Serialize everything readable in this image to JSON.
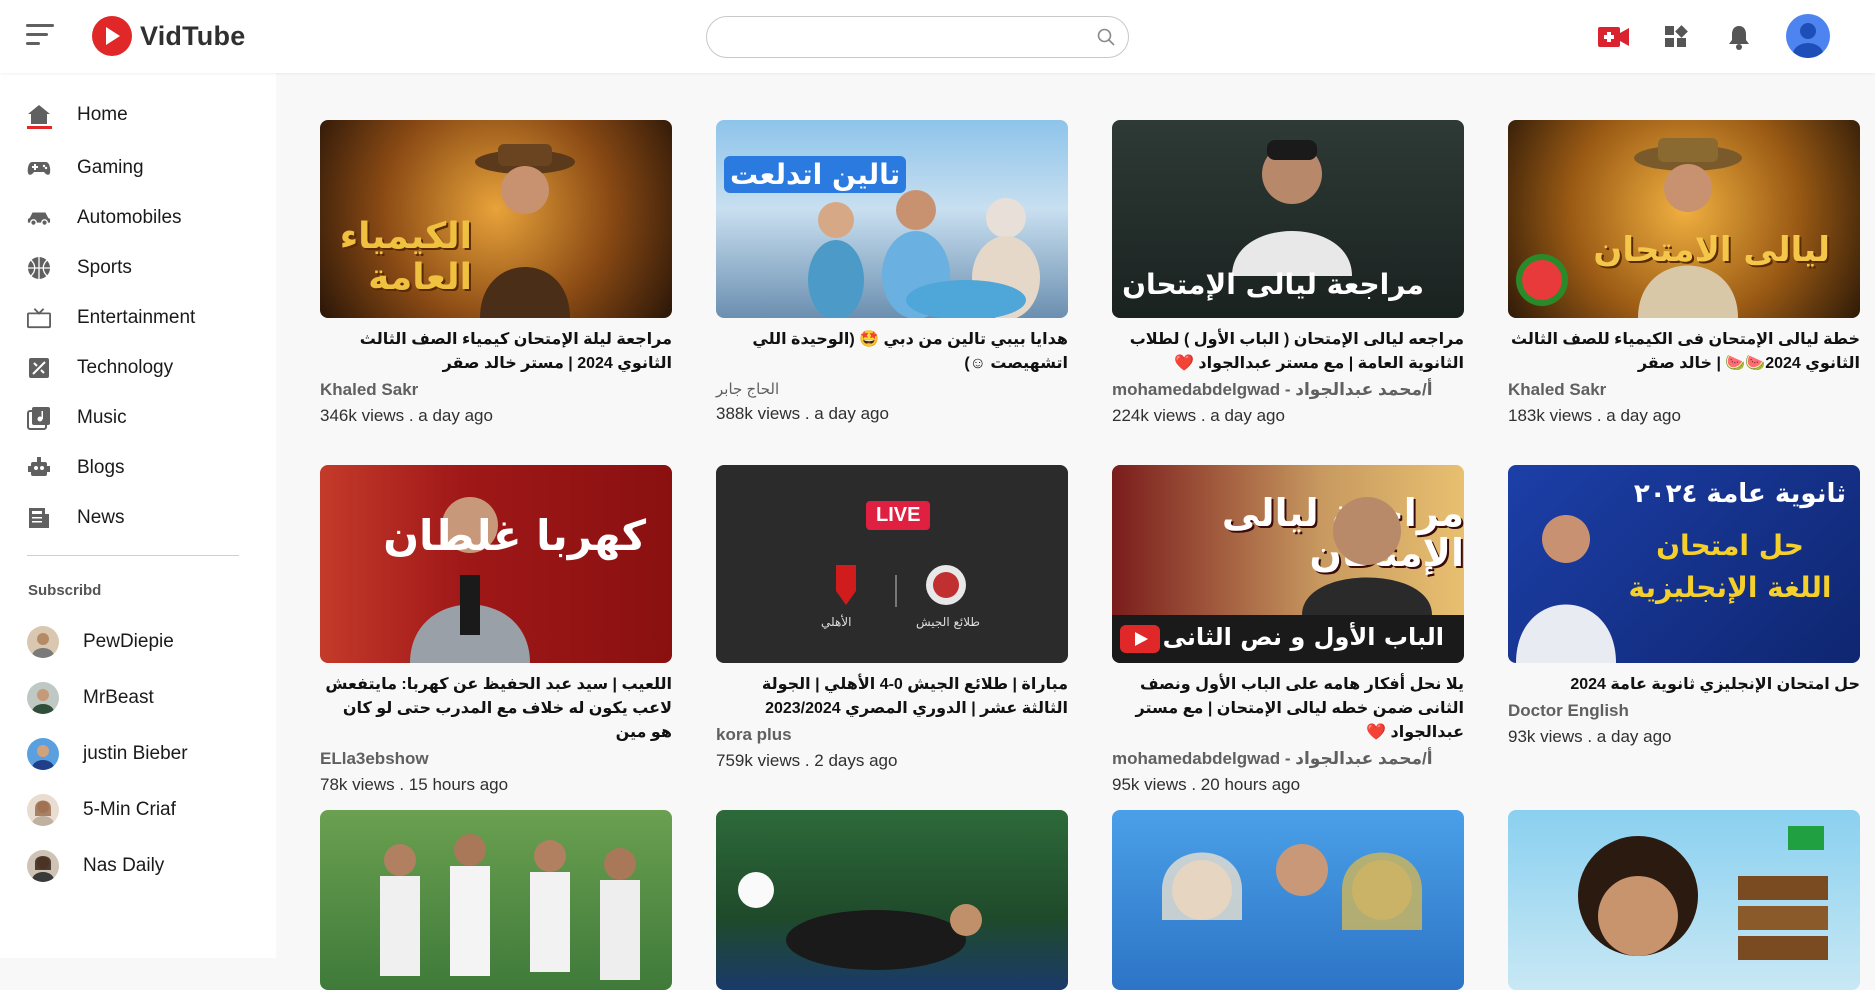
{
  "app": {
    "name": "VidTube",
    "brand_color": "#e02828"
  },
  "search": {
    "value": "",
    "placeholder": ""
  },
  "sidebar": {
    "items": [
      {
        "label": "Home",
        "icon": "home-icon",
        "active": true
      },
      {
        "label": "Gaming",
        "icon": "gamepad-icon"
      },
      {
        "label": "Automobiles",
        "icon": "car-icon"
      },
      {
        "label": "Sports",
        "icon": "basketball-icon"
      },
      {
        "label": "Entertainment",
        "icon": "tv-icon"
      },
      {
        "label": "Technology",
        "icon": "technology-icon"
      },
      {
        "label": "Music",
        "icon": "music-icon"
      },
      {
        "label": "Blogs",
        "icon": "blog-icon"
      },
      {
        "label": "News",
        "icon": "newspaper-icon"
      }
    ],
    "subscribed_heading": "Subscribd",
    "subscriptions": [
      {
        "name": "PewDiepie"
      },
      {
        "name": "MrBeast"
      },
      {
        "name": "justin Bieber"
      },
      {
        "name": "5-Min Criaf"
      },
      {
        "name": "Nas Daily"
      }
    ]
  },
  "videos": [
    {
      "title": "مراجعة ليلة الإمتحان كيمياء الصف الثالث الثانوي 2024 | مستر خالد صقر",
      "channel": "Khaled Sakr",
      "meta": "346k views . a day ago",
      "thumb_text": "الكيمياء العامة",
      "thumb_bg": "#3a2410"
    },
    {
      "title": "هدايا بيبي تالين من دبي 🤩 (الوحيدة اللي اتشهيصت ☺)",
      "channel": "الحاج جابر",
      "meta": "388k views . a day ago",
      "thumb_text": "تالين اتدلعت",
      "thumb_bg": "#5a8fc8"
    },
    {
      "title": "مراجعه ليالى الإمتحان ( الباب الأول ) لطلاب الثانوية العامة | مع مستر عبدالجواد ❤️",
      "channel": "mohamedabdelgwad - أ/محمد عبدالجواد",
      "meta": "224k views . a day ago",
      "thumb_text": "مراجعة ليالى الإمتحان",
      "thumb_bg": "#1e2a28"
    },
    {
      "title": "خطة ليالى الإمتحان فى الكيمياء للصف الثالث الثانوي 2024🍉🍉 | خالد صقر",
      "channel": "Khaled Sakr",
      "meta": "183k views . a day ago",
      "thumb_text": "ليالى الامتحان",
      "thumb_bg": "#4a2e10"
    },
    {
      "title": "اللعيب | سيد عبد الحفيظ عن كهربا: مايتفعش لاعب يكون له خلاف مع المدرب حتى لو كان هو مين",
      "channel": "ELla3ebshow",
      "meta": "78k views . 15 hours ago",
      "thumb_text": "كهربا غلطان",
      "thumb_bg": "#9e1414"
    },
    {
      "title": "مباراة | طلائع الجيش 0-4 الأهلي | الجولة الثالثة عشر | الدوري المصري 2023/2024",
      "channel": "kora plus",
      "meta": "759k views . 2 days ago",
      "thumb_text": "LIVE",
      "thumb_bg": "#2b2b2b",
      "team_a": "طلائع الجيش",
      "team_b": "الأهلي"
    },
    {
      "title": "يلا نحل أفكار هامه على الباب الأول ونصف الثانى ضمن خطه ليالى الإمتحان | مع مستر عبدالجواد ❤️",
      "channel": "mohamedabdelgwad - أ/محمد عبدالجواد",
      "meta": "95k views . 20 hours ago",
      "thumb_text": "مراجعة ليالى الإمتحان",
      "thumb_text2": "الباب الأول و نص الثانى",
      "thumb_bg": "#5a1818"
    },
    {
      "title": "حل امتحان الإنجليزي ثانوية عامة 2024",
      "channel": "Doctor English",
      "meta": "93k views . a day ago",
      "thumb_text": "ثانوية عامة ٢٠٢٤",
      "thumb_text2": "حل امتحان اللغة الإنجليزية",
      "thumb_bg": "#17338a"
    },
    {
      "title": "",
      "channel": "",
      "meta": "",
      "thumb_bg": "#3f7a3a"
    },
    {
      "title": "",
      "channel": "",
      "meta": "",
      "thumb_bg": "#1f5e3a"
    },
    {
      "title": "",
      "channel": "",
      "meta": "",
      "thumb_bg": "#2d74c6"
    },
    {
      "title": "",
      "channel": "",
      "meta": "",
      "thumb_bg": "#6fb9d8"
    }
  ]
}
